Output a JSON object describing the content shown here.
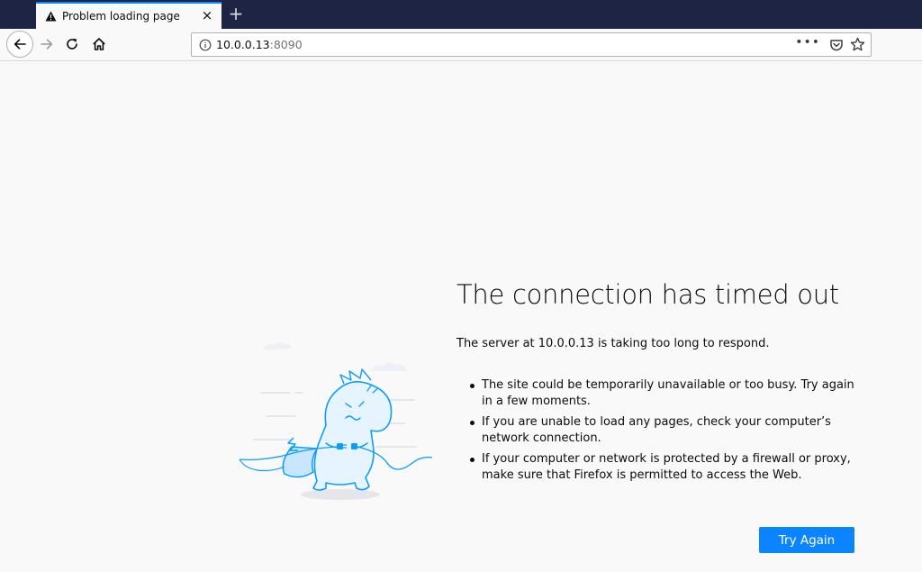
{
  "browser": {
    "tab_title": "Problem loading page",
    "tab_close": "×",
    "new_tab": "+",
    "url_host": "10.0.0.13",
    "url_port": ":8090",
    "page_actions": "•••"
  },
  "error": {
    "title": "The connection has timed out",
    "description": "The server at 10.0.0.13 is taking too long to respond.",
    "bullets": [
      "The site could be temporarily unavailable or too busy. Try again in a few moments.",
      "If you are unable to load any pages, check your computer’s network connection.",
      "If your computer or network is protected by a firewall or proxy, make sure that Firefox is permitted to access the Web."
    ],
    "button": "Try Again"
  },
  "colors": {
    "tab_strip": "#1d2444",
    "accent": "#0a84ff",
    "background": "#f9f9fa",
    "illustration": "#0a9dff"
  },
  "icons": [
    "warning-icon",
    "close-icon",
    "plus-icon",
    "back-arrow-icon",
    "forward-arrow-icon",
    "reload-icon",
    "home-icon",
    "info-icon",
    "pocket-icon",
    "star-icon"
  ]
}
